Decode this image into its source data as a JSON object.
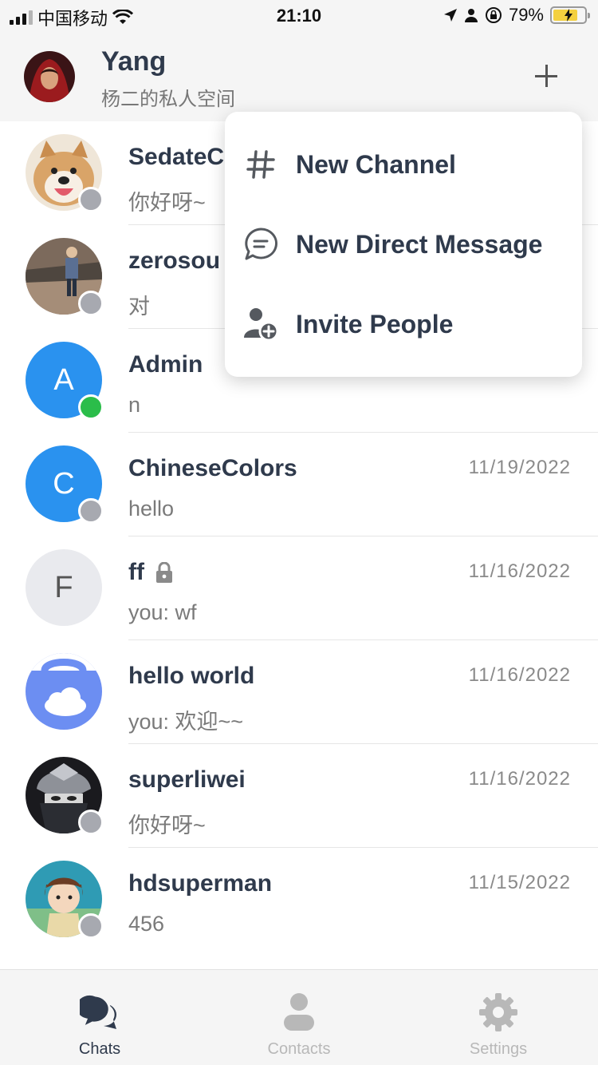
{
  "status_bar": {
    "carrier": "中国移动",
    "time": "21:10",
    "battery": "79%",
    "battery_level": 0.79
  },
  "header": {
    "name": "Yang",
    "subtitle": "杨二的私人空间"
  },
  "menu": {
    "items": [
      {
        "label": "New Channel",
        "icon": "hash-icon"
      },
      {
        "label": "New Direct Message",
        "icon": "chat-bubble-icon"
      },
      {
        "label": "Invite People",
        "icon": "add-person-icon"
      }
    ]
  },
  "chats": [
    {
      "name": "SedateC",
      "message": "你好呀~",
      "date": "",
      "status": "offline",
      "avatar": "dog-photo"
    },
    {
      "name": "zerosou",
      "message": "对",
      "date": "",
      "status": "offline",
      "avatar": "person-photo"
    },
    {
      "name": "Admin",
      "message": "n",
      "date": "",
      "status": "online",
      "avatar_letter": "A",
      "avatar_color": "#2a92ef"
    },
    {
      "name": "ChineseColors",
      "message": "hello",
      "date": "11/19/2022",
      "status": "offline",
      "avatar_letter": "C",
      "avatar_color": "#2a92ef"
    },
    {
      "name": "ff",
      "message": "you: wf",
      "date": "11/16/2022",
      "status": "none",
      "avatar_letter": "F",
      "avatar_color": "#e9eaee",
      "locked": true
    },
    {
      "name": "hello world",
      "message": "you: 欢迎~~",
      "date": "11/16/2022",
      "status": "none",
      "avatar": "cloud-bag-icon"
    },
    {
      "name": "superliwei",
      "message": "你好呀~",
      "date": "11/16/2022",
      "status": "offline",
      "avatar": "ninja-photo"
    },
    {
      "name": "hdsuperman",
      "message": "456",
      "date": "11/15/2022",
      "status": "offline",
      "avatar": "anime-girl-photo"
    }
  ],
  "tabs": [
    {
      "label": "Chats",
      "icon": "chats-icon",
      "active": true
    },
    {
      "label": "Contacts",
      "icon": "contacts-icon",
      "active": false
    },
    {
      "label": "Settings",
      "icon": "settings-icon",
      "active": false
    }
  ],
  "colors": {
    "online": "#2bbd4a",
    "offline": "#a7a9b0",
    "accent": "#2a92ef",
    "text": "#2f3a4c"
  }
}
